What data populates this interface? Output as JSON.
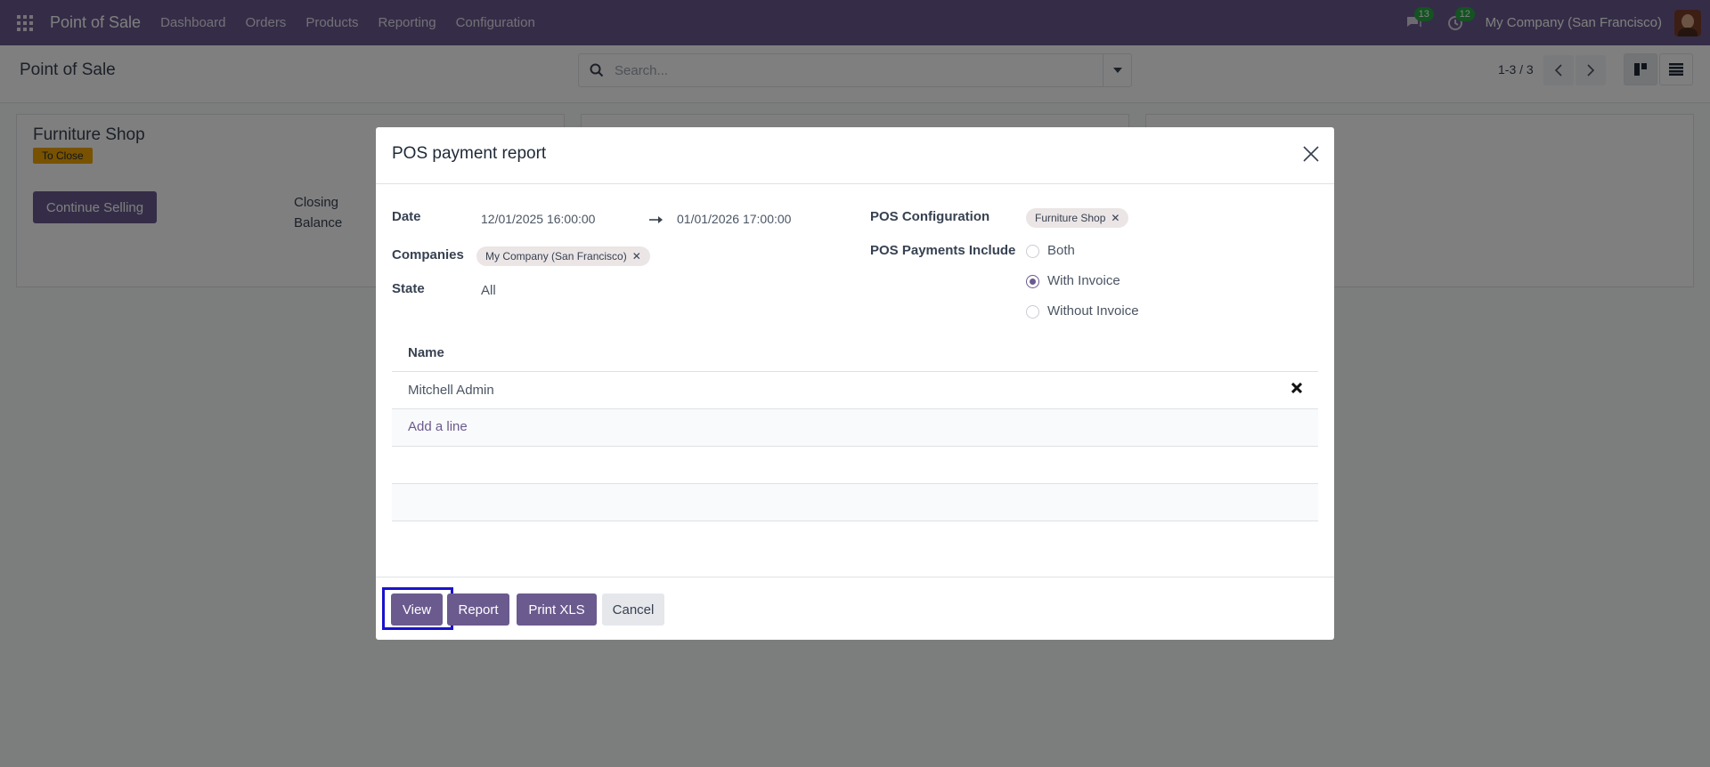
{
  "navbar": {
    "app_name": "Point of Sale",
    "menu": [
      "Dashboard",
      "Orders",
      "Products",
      "Reporting",
      "Configuration"
    ],
    "messages_count": "13",
    "activities_count": "12",
    "company": "My Company (San Francisco)"
  },
  "control": {
    "title": "Point of Sale",
    "search_placeholder": "Search...",
    "pager": "1-3 / 3"
  },
  "card": {
    "name": "Furniture Shop",
    "status": "To Close",
    "continue_label": "Continue Selling",
    "closing_label": "Closing Balance"
  },
  "modal": {
    "title": "POS payment report",
    "date_label": "Date",
    "date_from": "12/01/2025 16:00:00",
    "date_to": "01/01/2026 17:00:00",
    "companies_label": "Companies",
    "company_tag": "My Company (San Francisco)",
    "state_label": "State",
    "state_value": "All",
    "pos_config_label": "POS Configuration",
    "pos_config_tag": "Furniture Shop",
    "payments_include_label": "POS Payments Include",
    "payment_options": [
      "Both",
      "With Invoice",
      "Without Invoice"
    ],
    "payment_selected": "With Invoice",
    "table_header": "Name",
    "rows": [
      "Mitchell Admin"
    ],
    "add_line": "Add a line",
    "buttons": {
      "view": "View",
      "report": "Report",
      "print_xls": "Print XLS",
      "cancel": "Cancel"
    }
  }
}
